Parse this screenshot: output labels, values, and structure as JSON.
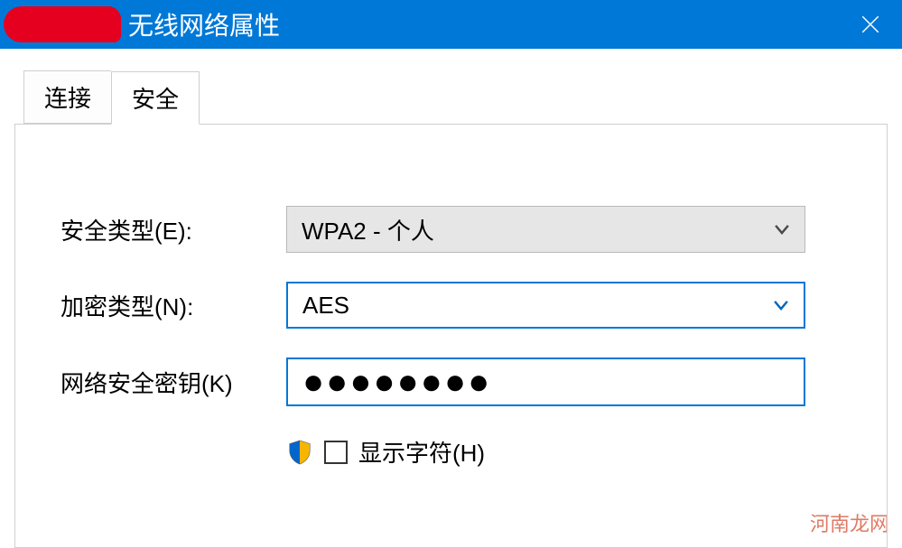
{
  "titlebar": {
    "title": "无线网络属性"
  },
  "tabs": {
    "connection": "连接",
    "security": "安全"
  },
  "form": {
    "security_type_label": "安全类型(E):",
    "security_type_value": "WPA2 - 个人",
    "encryption_type_label": "加密类型(N):",
    "encryption_type_value": "AES",
    "network_key_label": "网络安全密钥(K)",
    "network_key_masked": "●●●●●●●●",
    "show_chars_label": "显示字符(H)"
  },
  "watermark": "河南龙网"
}
